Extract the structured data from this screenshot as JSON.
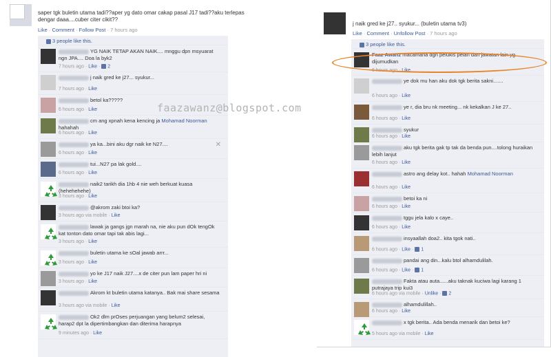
{
  "watermark": "faazawanz@blogspot.com",
  "left": {
    "post": {
      "text": "saper tgk buletin utama tadi??aper yg dato omar cakap pasal J17 tadi??aku terlepas dengar daaa....cuber citer cikit??",
      "actions": [
        "Like",
        "Comment",
        "Follow Post"
      ],
      "time": "7 hours ago"
    },
    "likes": "3 people like this.",
    "comments": [
      {
        "text": "YG NAIK TETAP AKAN NAIK.... mnggu dpn msyuarat ngn JPA.... Doa la byk2",
        "time": "7 hours ago",
        "like": "Like",
        "likes": "2"
      },
      {
        "text": "j naik gred ke j27... syukur...",
        "time": "7 hours ago",
        "like": "Like"
      },
      {
        "text": "betol ka?????",
        "time": "6 hours ago",
        "like": "Like"
      },
      {
        "text": "cm ang xpnah kena kencing ja",
        "link": "Mohamad Noorman",
        "tail": "hahahah",
        "time": "6 hours ago",
        "like": "Like"
      },
      {
        "text": "ya ka...bini aku dgr naik ke N27....",
        "time": "6 hours ago",
        "like": "Like"
      },
      {
        "text": "tui...N27 pa lak gold....",
        "time": "6 hours ago",
        "like": "Like"
      },
      {
        "text": "naik2 tarikh dia 1hb 4 nie weh berkuat kuasa (hehehehehe)",
        "time": "3 hours ago",
        "like": "Like"
      },
      {
        "text": "@akrom zaki btoi ka?",
        "time": "3 hours ago",
        "via": "via mobile",
        "like": "Like"
      },
      {
        "text": "lawak ja gangs jgn marah na, nie aku pun dOk tengOk kat tonton dato omar tapi tak abis lagi...",
        "time": "3 hours ago",
        "like": "Like"
      },
      {
        "text": "buletin utama ke sOal jawab arrr...",
        "time": "3 hours ago",
        "like": "Like"
      },
      {
        "text": "yo ke J17 naik J27....x de citer pun lam paper hri ni",
        "time": "3 hours ago",
        "like": "Like"
      },
      {
        "text": "Akrom kt buletin utama katanya.. Bak mai share sesama",
        "time": "3 hours ago",
        "via": "via mobile",
        "like": "Like"
      },
      {
        "text": "Ok2 dlm prOses perjuangan yang belum2 selesai, harap2 dpt la dipertimbangkan dan diterima harapnya",
        "time": "9 minutes ago",
        "like": "Like"
      }
    ]
  },
  "right": {
    "post": {
      "text": "j naik gred ke j27.. syukur... (buletin utama tv3)",
      "actions": [
        "Like",
        "Comment",
        "Unfollow Post"
      ],
      "time": "7 hours ago"
    },
    "likes": "3 people like this.",
    "highlight": {
      "name": "Faaz Awanz",
      "text": "macamana dgn pelukis pelan dan jawatan lain yg dijumudkan",
      "time": "6 hours ago",
      "like": "Like"
    },
    "comments": [
      {
        "text": "ye dok mu han aku dok tgk berita sakni.......",
        "time": "6 hours ago",
        "like": "Like"
      },
      {
        "text": "ye r, dia bru nk meeting... nk kekalkan J ke 27..",
        "time": "6 hours ago",
        "like": "Like"
      },
      {
        "text": "syukur",
        "time": "6 hours ago",
        "like": "Like"
      },
      {
        "text": "aku tgk berita gak tp tak da benda pun....tolong huraikan lebih lanjut",
        "time": "6 hours ago",
        "like": "Like"
      },
      {
        "text": "astro ang delay kot.. hahah",
        "link": "Mohamad Noorman",
        "time": "6 hours ago",
        "like": "Like"
      },
      {
        "text": "betoi ka ni",
        "time": "6 hours ago",
        "like": "Like"
      },
      {
        "text": "tggu jela kalo x caye..",
        "time": "6 hours ago",
        "like": "Like"
      },
      {
        "text": "insyaallah doa2.. kita tgok nati..",
        "time": "6 hours ago",
        "like": "Like",
        "likes": "1"
      },
      {
        "text": "pandai ang din...kalu btol alhamdulilah.",
        "time": "6 hours ago",
        "like": "Like",
        "likes": "1"
      },
      {
        "text": "Fakta atau auta......aku taknak kuciwa lagi karang 1 putrajaya trip kui3",
        "time": "6 hours ago",
        "via": "via mobile",
        "like": "Unlike",
        "likes": "2"
      },
      {
        "text": "alhamdulillah..",
        "time": "6 hours ago",
        "like": "Like"
      },
      {
        "text": "x tgk berita.. Ada benda menarik dan betoi ke?",
        "time": "5 hours ago",
        "via": "via mobile",
        "like": "Like"
      }
    ]
  }
}
